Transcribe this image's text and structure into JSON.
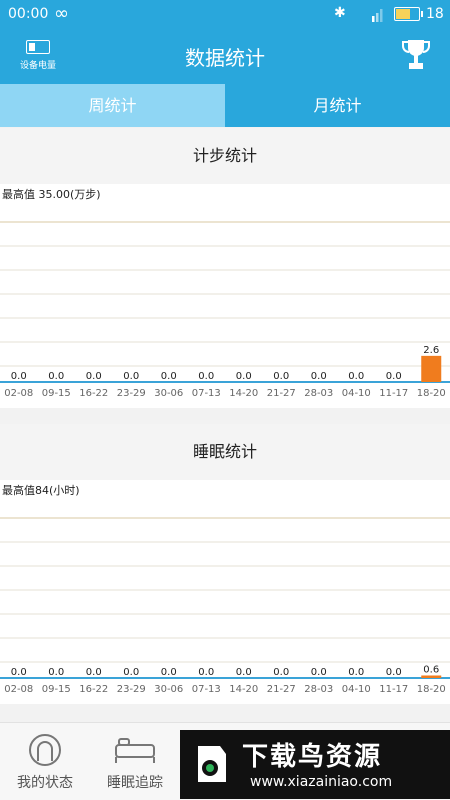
{
  "status_bar": {
    "time": "00:00",
    "battery_pct": "18"
  },
  "header": {
    "device_battery_label": "设备电量",
    "title": "数据统计"
  },
  "tabs": [
    {
      "label": "周统计"
    },
    {
      "label": "月统计"
    }
  ],
  "step_section": {
    "title": "计步统计",
    "max_label": "最高值   35.00(万步)"
  },
  "sleep_section": {
    "title": "睡眠统计",
    "max_label": "最高值84(小时)"
  },
  "chart_data": [
    {
      "type": "bar",
      "title": "计步统计",
      "categories": [
        "02-08",
        "09-15",
        "16-22",
        "23-29",
        "30-06",
        "07-13",
        "14-20",
        "21-27",
        "28-03",
        "04-10",
        "11-17",
        "18-20"
      ],
      "values": [
        0,
        0,
        0,
        0,
        0,
        0,
        0,
        0,
        0,
        0,
        0,
        2.6
      ],
      "value_labels": [
        "0.0",
        "0.0",
        "0.0",
        "0.0",
        "0.0",
        "0.0",
        "0.0",
        "0.0",
        "0.0",
        "0.0",
        "0.0",
        "2.6"
      ],
      "ylim": [
        0,
        35
      ],
      "grid": true,
      "bar_color": "#f07c1e"
    },
    {
      "type": "bar",
      "title": "睡眠统计",
      "categories": [
        "02-08",
        "09-15",
        "16-22",
        "23-29",
        "30-06",
        "07-13",
        "14-20",
        "21-27",
        "28-03",
        "04-10",
        "11-17",
        "18-20"
      ],
      "values": [
        0,
        0,
        0,
        0,
        0,
        0,
        0,
        0,
        0,
        0,
        0,
        0.6
      ],
      "value_labels": [
        "0.0",
        "0.0",
        "0.0",
        "0.0",
        "0.0",
        "0.0",
        "0.0",
        "0.0",
        "0.0",
        "0.0",
        "0.0",
        "0.6"
      ],
      "ylim": [
        0,
        84
      ],
      "grid": true,
      "bar_color": "#f07c1e"
    }
  ],
  "bottom_nav": [
    {
      "label": "我的状态"
    },
    {
      "label": "睡眠追踪"
    }
  ],
  "promo": {
    "brand": "下载鸟资源",
    "url": "www.xiazainiao.com"
  },
  "colors": {
    "primary": "#29a7dc",
    "tab_active": "#8fd6f4",
    "bar": "#f07c1e",
    "axis": "#3aa3d8",
    "grid": "#e6e1d4"
  }
}
